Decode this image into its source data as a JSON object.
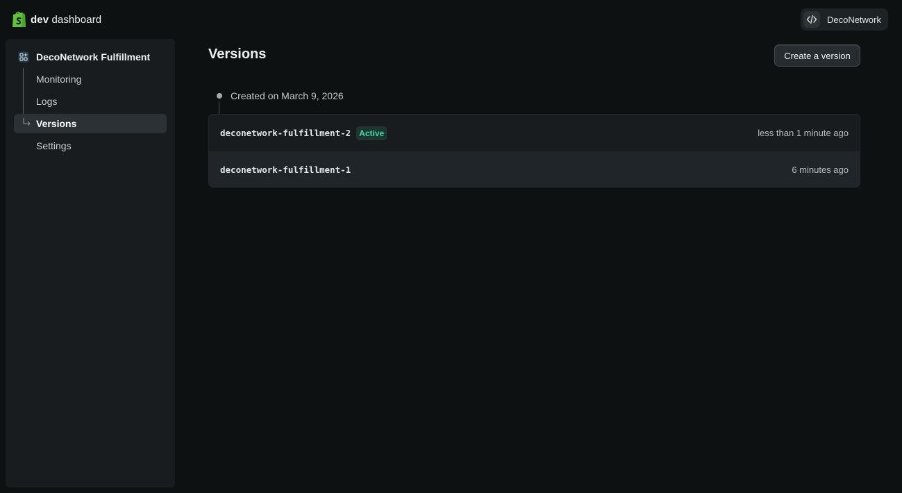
{
  "header": {
    "brand_bold": "dev",
    "brand_rest": "dashboard",
    "org_name": "DecoNetwork"
  },
  "sidebar": {
    "app_title": "DecoNetwork Fulfillment",
    "items": [
      {
        "label": "Monitoring"
      },
      {
        "label": "Logs"
      },
      {
        "label": "Versions",
        "active": true
      },
      {
        "label": "Settings"
      }
    ]
  },
  "main": {
    "title": "Versions",
    "create_button": "Create a version",
    "created_label": "Created on March 9, 2026",
    "versions": [
      {
        "name": "deconetwork-fulfillment-2",
        "badge": "Active",
        "time": "less than 1 minute ago"
      },
      {
        "name": "deconetwork-fulfillment-1",
        "time": "6 minutes ago"
      }
    ]
  },
  "colors": {
    "background": "#0d1112",
    "sidebar": "#181c1e",
    "active_badge_text": "#3fd8a4",
    "brand_green": "#5fc43c"
  },
  "icons": {
    "brand": "shopify-bag-icon",
    "org": "code-icon",
    "app": "app-grid-icon",
    "nav_active": "arrow-turn-right-icon"
  }
}
